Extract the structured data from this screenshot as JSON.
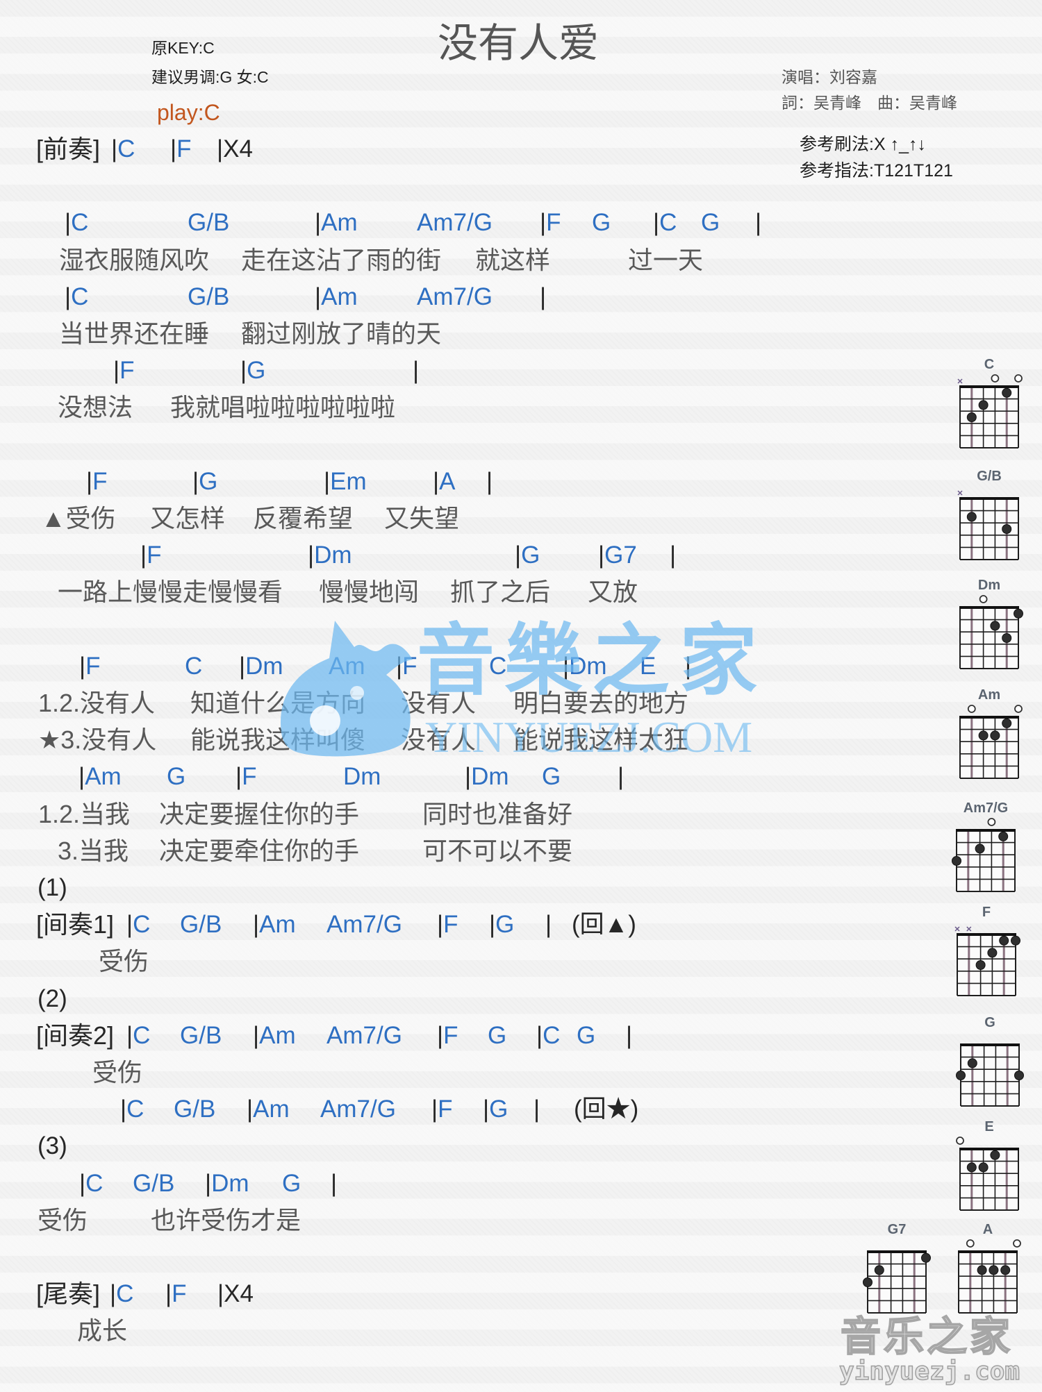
{
  "title": "没有人爱",
  "key_info": {
    "original_key": "原KEY:C",
    "suggested_key": "建议男调:G 女:C",
    "play_key": "play:C"
  },
  "credits": {
    "singer": "演唱：刘容嘉",
    "writers": "詞：吴青峰　曲：吴青峰"
  },
  "reference": {
    "strumming": "参考刷法:X ↑_↑↓",
    "fingerpicking": "参考指法:T121T121"
  },
  "symbols": {
    "bar": "|"
  },
  "colors": {
    "chord": "#2e6fc2",
    "lyric": "#585858",
    "symbol": "#262626",
    "title": "#555555",
    "play_key": "#c2561e",
    "watermark": "#78bdf0"
  },
  "intro": {
    "label": "[前奏]",
    "chords": [
      "C",
      "F"
    ],
    "repeat": "X4"
  },
  "verse": [
    {
      "chords": [
        "C",
        "G/B",
        "Am",
        "Am7/G",
        "F",
        "G",
        "C",
        "G"
      ],
      "lyrics": [
        "湿衣服随风吹",
        "走在这沾了雨的街",
        "就这样",
        "过一天"
      ]
    },
    {
      "chords": [
        "C",
        "G/B",
        "Am",
        "Am7/G"
      ],
      "lyrics": [
        "当世界还在睡",
        "翻过刚放了晴的天"
      ]
    },
    {
      "chords": [
        "F",
        "G"
      ],
      "lyrics": [
        "没想法",
        "我就唱啦啦啦啦啦啦"
      ]
    }
  ],
  "prechorus": [
    {
      "chords": [
        "F",
        "G",
        "Em",
        "A"
      ],
      "lyrics": [
        "▲受伤",
        "又怎样",
        "反覆希望",
        "又失望"
      ]
    },
    {
      "chords": [
        "F",
        "Dm",
        "G",
        "G7"
      ],
      "lyrics": [
        "一路上慢慢走慢慢看",
        "慢慢地闯",
        "抓了之后",
        "又放"
      ]
    }
  ],
  "chorus": [
    {
      "chords": [
        "F",
        "C",
        "Dm",
        "Am",
        "F",
        "C",
        "Dm",
        "E"
      ],
      "lyrics_a": [
        "1.2.没有人",
        "知道什么是方向",
        "没有人",
        "明白要去的地方"
      ],
      "lyrics_b": [
        "★3.没有人",
        "能说我这样叫傻",
        "没有人",
        "能说我这样太狂"
      ]
    },
    {
      "chords": [
        "Am",
        "G",
        "F",
        "Dm",
        "Dm",
        "G"
      ],
      "lyrics_a": [
        "1.2.当我",
        "决定要握住你的手",
        "同时也准备好"
      ],
      "lyrics_b": [
        "3.当我",
        "决定要牵住你的手",
        "可不可以不要"
      ]
    }
  ],
  "endings": [
    {
      "marker": "(1)",
      "label": "[间奏1]",
      "chords": [
        "C",
        "G/B",
        "Am",
        "Am7/G",
        "F",
        "G"
      ],
      "return": "(回▲)",
      "lyrics": [
        "受伤"
      ]
    },
    {
      "marker": "(2)",
      "label": "[间奏2]",
      "chords": [
        "C",
        "G/B",
        "Am",
        "Am7/G",
        "F",
        "G",
        "C",
        "G"
      ],
      "lyrics": [
        "受伤"
      ],
      "chords_repeat": [
        "C",
        "G/B",
        "Am",
        "Am7/G",
        "F",
        "G"
      ],
      "return": "(回★)"
    },
    {
      "marker": "(3)",
      "chords": [
        "C",
        "G/B",
        "Dm",
        "G"
      ],
      "lyrics": [
        "受伤",
        "也许受伤才是"
      ]
    }
  ],
  "outro": {
    "label": "[尾奏]",
    "chords": [
      "C",
      "F"
    ],
    "repeat": "X4",
    "lyrics": [
      "成长"
    ]
  },
  "chord_diagrams": [
    {
      "name": "C",
      "muted": [
        6
      ],
      "open": [
        3,
        1
      ],
      "dots": [
        {
          "string": 5,
          "fret": 3
        },
        {
          "string": 4,
          "fret": 2
        },
        {
          "string": 2,
          "fret": 1
        }
      ]
    },
    {
      "name": "G/B",
      "muted": [
        6
      ],
      "open": [],
      "dots": [
        {
          "string": 5,
          "fret": 2
        },
        {
          "string": 2,
          "fret": 3
        }
      ]
    },
    {
      "name": "Dm",
      "muted": [],
      "open": [
        4
      ],
      "dots": [
        {
          "string": 3,
          "fret": 2
        },
        {
          "string": 2,
          "fret": 3
        },
        {
          "string": 1,
          "fret": 1
        }
      ]
    },
    {
      "name": "Am",
      "muted": [],
      "open": [
        5,
        1
      ],
      "dots": [
        {
          "string": 4,
          "fret": 2
        },
        {
          "string": 3,
          "fret": 2
        },
        {
          "string": 2,
          "fret": 1
        }
      ]
    },
    {
      "name": "Am7/G",
      "muted": [],
      "open": [
        3
      ],
      "dots": [
        {
          "string": 6,
          "fret": 3
        },
        {
          "string": 4,
          "fret": 2
        },
        {
          "string": 2,
          "fret": 1
        }
      ]
    },
    {
      "name": "F",
      "muted": [
        6,
        5
      ],
      "open": [],
      "dots": [
        {
          "string": 4,
          "fret": 3
        },
        {
          "string": 3,
          "fret": 2
        },
        {
          "string": 2,
          "fret": 1
        },
        {
          "string": 1,
          "fret": 1
        }
      ]
    },
    {
      "name": "G",
      "muted": [],
      "open": [],
      "dots": [
        {
          "string": 6,
          "fret": 3
        },
        {
          "string": 5,
          "fret": 2
        },
        {
          "string": 1,
          "fret": 3
        }
      ]
    },
    {
      "name": "E",
      "muted": [],
      "open": [
        6
      ],
      "dots": [
        {
          "string": 5,
          "fret": 2
        },
        {
          "string": 4,
          "fret": 2
        },
        {
          "string": 3,
          "fret": 1
        }
      ]
    },
    {
      "name": "G7",
      "muted": [],
      "open": [],
      "dots": [
        {
          "string": 6,
          "fret": 3
        },
        {
          "string": 5,
          "fret": 2
        },
        {
          "string": 1,
          "fret": 1
        }
      ]
    },
    {
      "name": "A",
      "muted": [],
      "open": [
        5,
        1
      ],
      "dots": [
        {
          "string": 4,
          "fret": 2
        },
        {
          "string": 3,
          "fret": 2
        },
        {
          "string": 2,
          "fret": 2
        }
      ]
    }
  ],
  "watermarks": {
    "center_cn": "音樂之家",
    "center_en": "YINYUEZJ.COM",
    "corner_cn": "音乐之家",
    "corner_en": "yinyuezj.com"
  }
}
